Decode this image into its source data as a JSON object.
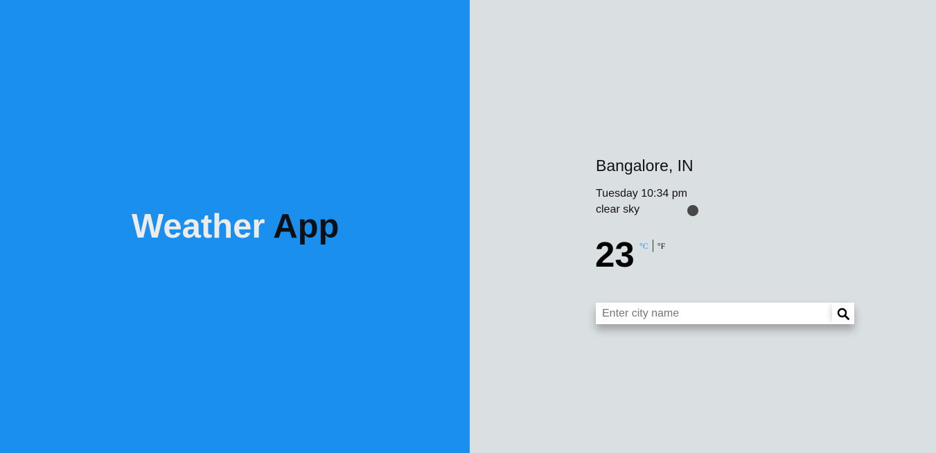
{
  "brand": {
    "word1": "Weather",
    "word2": "App"
  },
  "weather": {
    "location": "Bangalore, IN",
    "datetime": "Tuesday 10:34 pm",
    "description": "clear sky",
    "temperature": "23",
    "unit_celsius": "°C",
    "unit_fahrenheit": "°F",
    "weather_icon": "weather-icon"
  },
  "search": {
    "placeholder": "Enter city name",
    "value": "",
    "button_icon": "search-icon"
  },
  "colors": {
    "left_panel": "#1a8fee",
    "right_panel": "#dadfe1",
    "accent": "#1a8fee"
  }
}
